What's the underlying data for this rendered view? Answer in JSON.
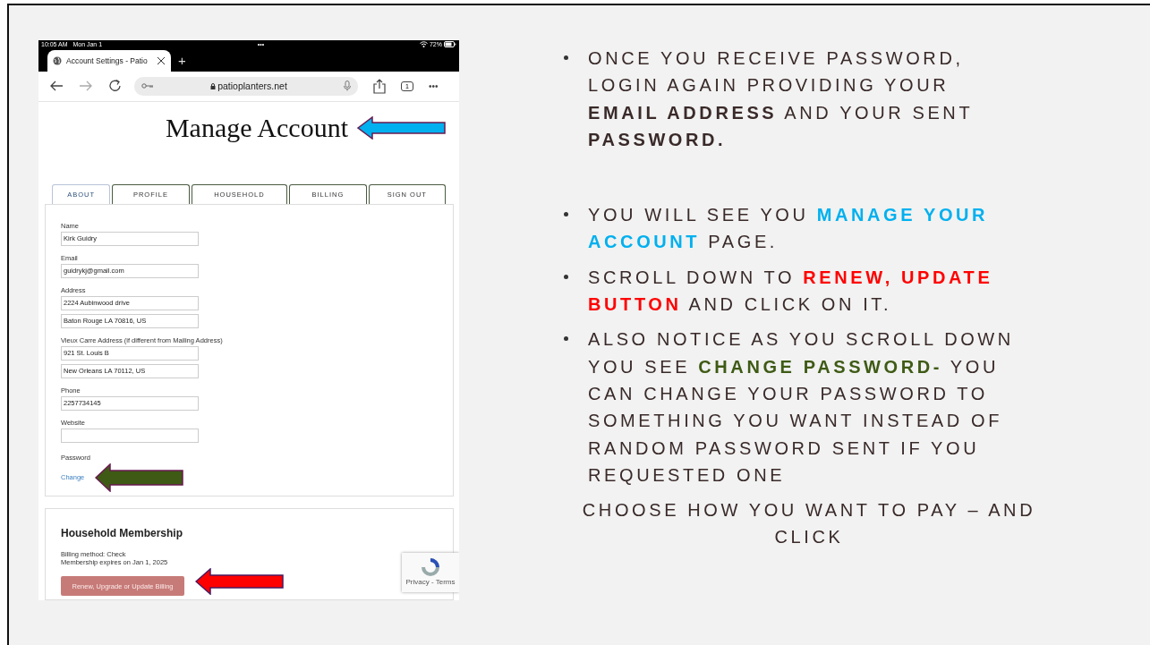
{
  "device_status": {
    "time": "10:05 AM",
    "date": "Mon Jan 1",
    "dots": "•••",
    "battery": "72%"
  },
  "browser": {
    "tab_title": "Account Settings - Patio",
    "new_tab": "+",
    "url": "patioplanters.net",
    "tab_count": "1",
    "more": "•••"
  },
  "page": {
    "title": "Manage Account",
    "tabs": [
      {
        "label": "ABOUT",
        "selected": true
      },
      {
        "label": "PROFILE",
        "selected": false
      },
      {
        "label": "HOUSEHOLD",
        "selected": false
      },
      {
        "label": "BILLING",
        "selected": false
      },
      {
        "label": "SIGN OUT",
        "selected": false
      }
    ],
    "fields": [
      {
        "label": "Name",
        "values": [
          "Kirk Guidry"
        ]
      },
      {
        "label": "Email",
        "values": [
          "guidrykj@gmail.com"
        ]
      },
      {
        "label": "Address",
        "values": [
          "2224 Aubinwood drive",
          "Baton Rouge LA 70816, US"
        ]
      },
      {
        "label": "Vieux Carre Address (if different from Mailing Address)",
        "values": [
          "921 St. Louis B",
          "New Orleans LA 70112, US"
        ]
      },
      {
        "label": "Phone",
        "values": [
          "2257734145"
        ]
      },
      {
        "label": "Website"
      }
    ],
    "password": {
      "label": "Password",
      "link": "Change"
    },
    "membership": {
      "heading": "Household Membership",
      "billing_method": "Billing method: Check",
      "expires": "Membership expires on Jan 1, 2025",
      "button": "Renew, Upgrade or Update Billing"
    },
    "recaptcha": {
      "links": "Privacy - Terms"
    }
  },
  "notes": [
    {
      "kind": "bullet",
      "segments": [
        {
          "text": "ONCE YOU RECEIVE PASSWORD, LOGIN AGAIN PROVIDING YOUR ",
          "kind": "plain"
        },
        {
          "text": "EMAIL ADDRESS",
          "kind": "bold"
        },
        {
          "text": " AND YOUR SENT ",
          "kind": "plain"
        },
        {
          "text": "PASSWORD.",
          "kind": "bold"
        }
      ]
    },
    {
      "kind": "bullet",
      "segments": [
        {
          "text": "YOU WILL SEE YOU ",
          "kind": "plain"
        },
        {
          "text": "MANAGE YOUR ACCOUNT",
          "kind": "highlight",
          "color": "#00b0ef"
        },
        {
          "text": " PAGE.",
          "kind": "plain"
        }
      ]
    },
    {
      "kind": "bullet",
      "segments": [
        {
          "text": "SCROLL DOWN TO ",
          "kind": "plain"
        },
        {
          "text": "RENEW, UPDATE BUTTON",
          "kind": "highlight",
          "color": "#ff0000"
        },
        {
          "text": " AND CLICK ON IT.",
          "kind": "plain"
        }
      ]
    },
    {
      "kind": "bullet",
      "segments": [
        {
          "text": "ALSO NOTICE AS YOU SCROLL DOWN YOU SEE ",
          "kind": "plain"
        },
        {
          "text": "CHANGE PASSWORD-",
          "kind": "highlight",
          "color": "#3f5a15"
        },
        {
          "text": " YOU CAN CHANGE YOUR PASSWORD TO SOMETHING YOU WANT INSTEAD OF RANDOM PASSWORD SENT IF YOU REQUESTED ONE",
          "kind": "plain"
        }
      ]
    },
    {
      "kind": "centered",
      "segments": [
        {
          "text": "CHOOSE HOW YOU WANT TO PAY – AND CLICK",
          "kind": "plain"
        }
      ]
    }
  ]
}
